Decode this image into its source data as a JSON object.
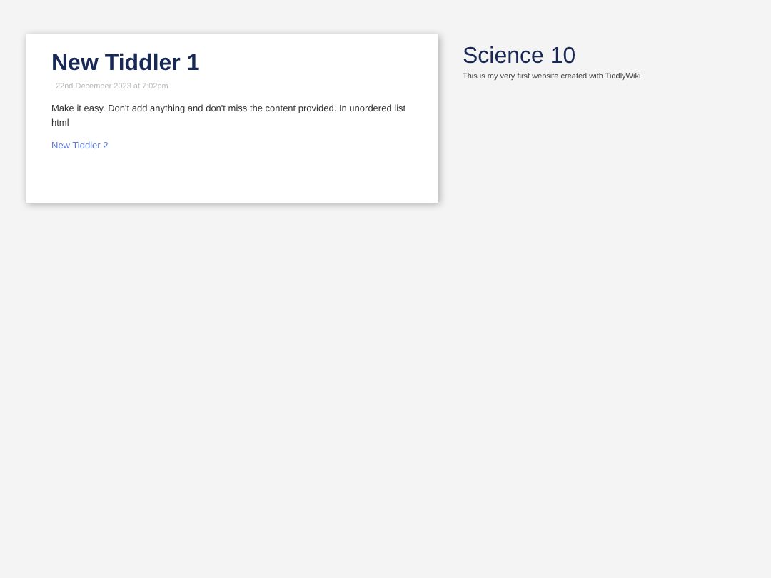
{
  "tiddler": {
    "title": "New Tiddler 1",
    "date": "22nd December 2023 at 7:02pm",
    "body": "Make it easy. Don't add anything and don't miss the content provided. In unordered list html",
    "link": "New Tiddler 2"
  },
  "sidebar": {
    "title": "Science 10",
    "subtitle": "This is my very first website created with TiddlyWiki"
  }
}
